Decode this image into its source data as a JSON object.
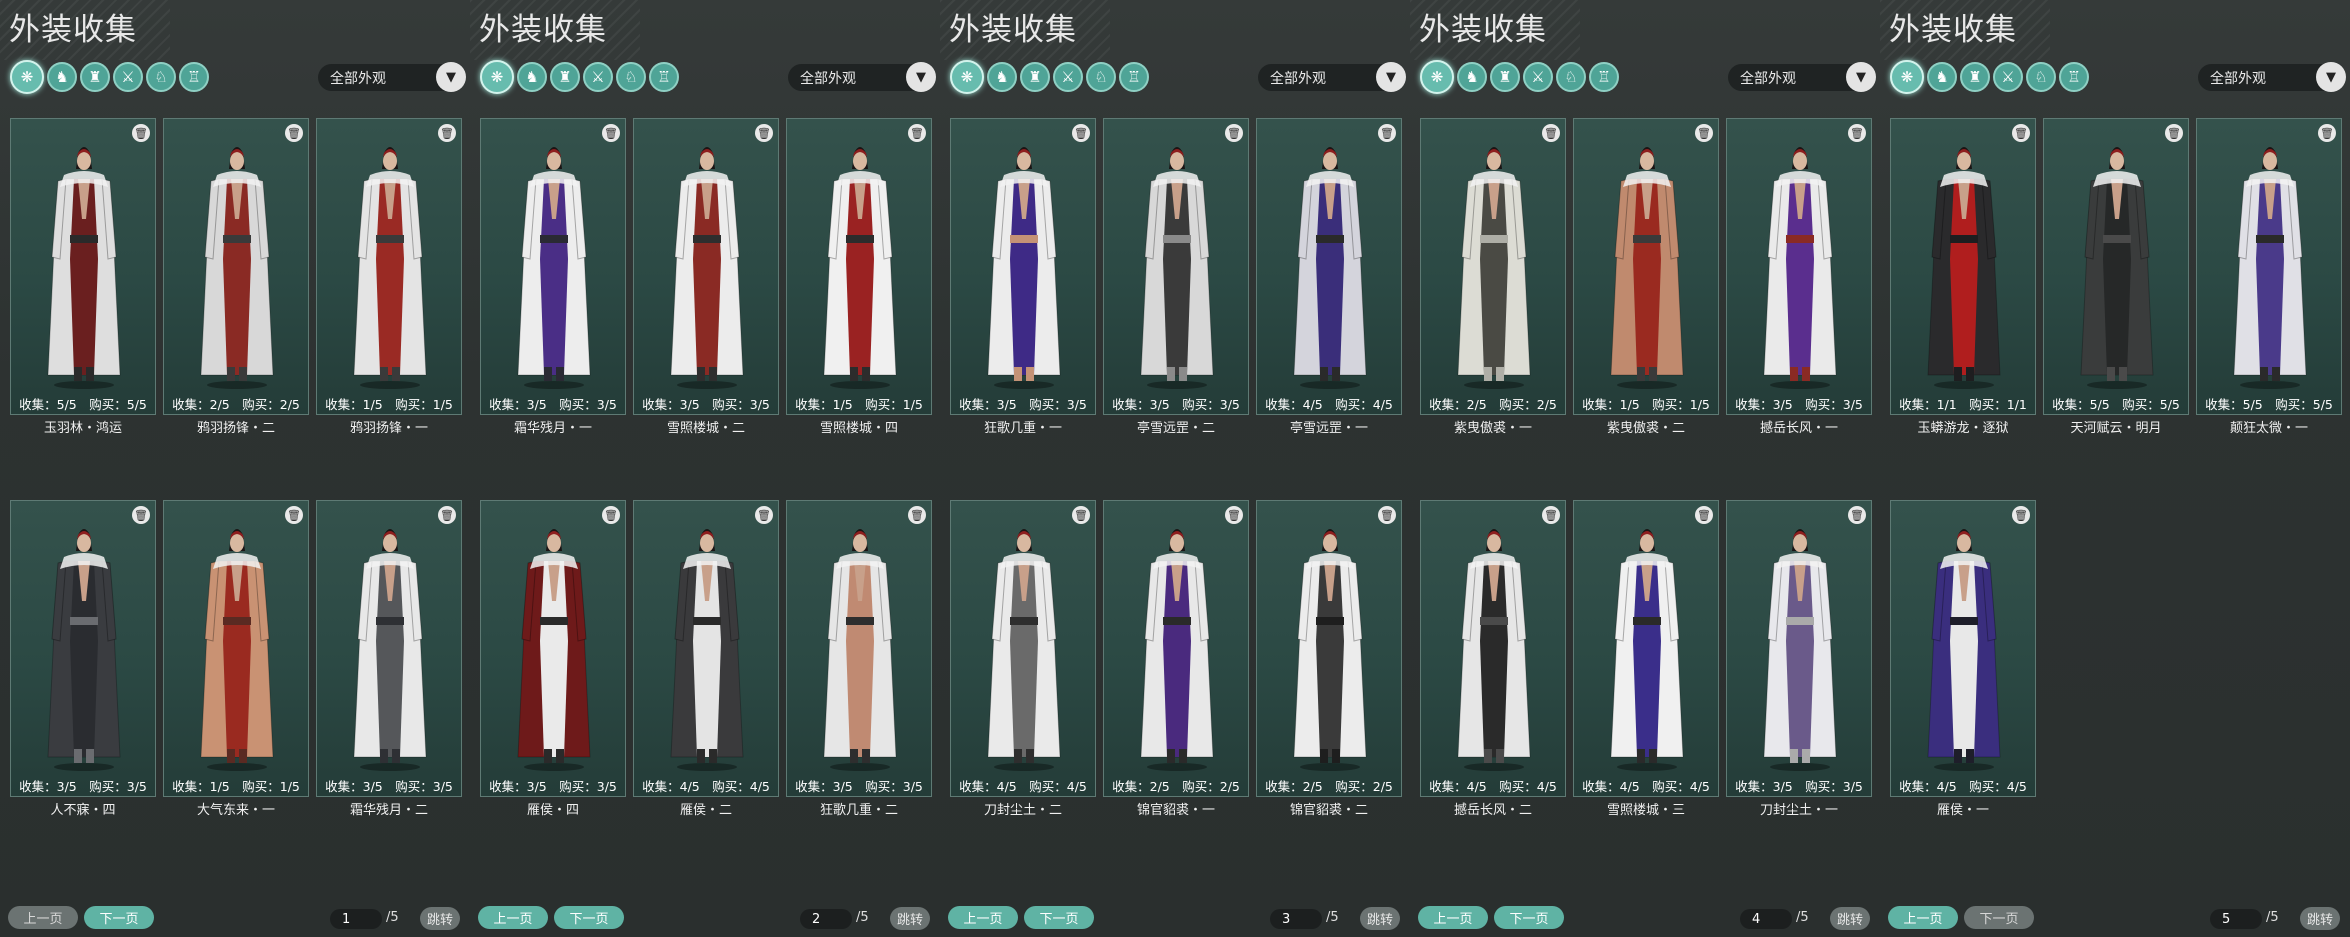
{
  "panels": [
    {
      "title": "外装收集",
      "filter_label": "全部外观",
      "page": "1",
      "total": "/5",
      "prev_label": "上一页",
      "next_label": "下一页",
      "jump_label": "跳转",
      "prev_enabled": false,
      "next_enabled": true,
      "items": [
        {
          "counts": "收集：5/5　购买：5/5",
          "name": "玉羽林・鸿运",
          "colors": [
            "#dedede",
            "#6a1f1f",
            "#2a2a2a"
          ]
        },
        {
          "counts": "收集：2/5　购买：2/5",
          "name": "鸦羽扬锋・二",
          "colors": [
            "#d8d8d8",
            "#8a2a24",
            "#3a3a3a"
          ]
        },
        {
          "counts": "收集：1/5　购买：1/5",
          "name": "鸦羽扬锋・一",
          "colors": [
            "#e4e4e4",
            "#9a2a24",
            "#3a3a3a"
          ]
        },
        {
          "counts": "收集：3/5　购买：3/5",
          "name": "人不寐・四",
          "colors": [
            "#3a3c40",
            "#2a2c30",
            "#6a6c70"
          ]
        },
        {
          "counts": "收集：1/5　购买：1/5",
          "name": "大气东来・一",
          "colors": [
            "#c99273",
            "#9a2a20",
            "#5a2a22"
          ]
        },
        {
          "counts": "收集：3/5　购买：3/5",
          "name": "霜华残月・二",
          "colors": [
            "#e8e8e8",
            "#55575a",
            "#2e3034"
          ]
        }
      ]
    },
    {
      "title": "外装收集",
      "filter_label": "全部外观",
      "page": "2",
      "total": "/5",
      "prev_label": "上一页",
      "next_label": "下一页",
      "jump_label": "跳转",
      "prev_enabled": true,
      "next_enabled": true,
      "items": [
        {
          "counts": "收集：3/5　购买：3/5",
          "name": "霜华残月・一",
          "colors": [
            "#ededed",
            "#4a2e86",
            "#2a2a34"
          ]
        },
        {
          "counts": "收集：3/5　购买：3/5",
          "name": "雪照楼城・二",
          "colors": [
            "#ececec",
            "#8a2a24",
            "#2e2e2e"
          ]
        },
        {
          "counts": "收集：1/5　购买：1/5",
          "name": "雪照楼城・四",
          "colors": [
            "#f0f0f0",
            "#9a2222",
            "#2c2c2c"
          ]
        },
        {
          "counts": "收集：3/5　购买：3/5",
          "name": "雁侯・四",
          "colors": [
            "#6e1a1a",
            "#eaeaea",
            "#2a2a2a"
          ]
        },
        {
          "counts": "收集：4/5　购买：4/5",
          "name": "雁侯・二",
          "colors": [
            "#3a3a3c",
            "#e4e4e4",
            "#2a2a2a"
          ]
        },
        {
          "counts": "收集：3/5　购买：3/5",
          "name": "狂歌几重・二",
          "colors": [
            "#e6e6e6",
            "#c08a72",
            "#2e2e2e"
          ]
        }
      ]
    },
    {
      "title": "外装收集",
      "filter_label": "全部外观",
      "page": "3",
      "total": "/5",
      "prev_label": "上一页",
      "next_label": "下一页",
      "jump_label": "跳转",
      "prev_enabled": true,
      "next_enabled": true,
      "items": [
        {
          "counts": "收集：3/5　购买：3/5",
          "name": "狂歌几重・一",
          "colors": [
            "#ececec",
            "#3e2a86",
            "#c49276"
          ]
        },
        {
          "counts": "收集：3/5　购买：3/5",
          "name": "亭雪远罡・二",
          "colors": [
            "#d8d8d8",
            "#3a3a3a",
            "#8a8a8a"
          ]
        },
        {
          "counts": "收集：4/5　购买：4/5",
          "name": "亭雪远罡・一",
          "colors": [
            "#d4d4dc",
            "#3a2e7a",
            "#2a2a2a"
          ]
        },
        {
          "counts": "收集：4/5　购买：4/5",
          "name": "刀封尘土・二",
          "colors": [
            "#eaeaea",
            "#6a6a6a",
            "#2e2e2e"
          ]
        },
        {
          "counts": "收集：2/5　购买：2/5",
          "name": "锦官貂裘・一",
          "colors": [
            "#e8e8e8",
            "#4a2a7e",
            "#2a2a2a"
          ]
        },
        {
          "counts": "收集：2/5　购买：2/5",
          "name": "锦官貂裘・二",
          "colors": [
            "#ececec",
            "#3a3a3a",
            "#1e1e1e"
          ]
        }
      ]
    },
    {
      "title": "外装收集",
      "filter_label": "全部外观",
      "page": "4",
      "total": "/5",
      "prev_label": "上一页",
      "next_label": "下一页",
      "jump_label": "跳转",
      "prev_enabled": true,
      "next_enabled": true,
      "items": [
        {
          "counts": "收集：2/5　购买：2/5",
          "name": "紫曳傲裘・一",
          "colors": [
            "#dcdcd4",
            "#4a4a44",
            "#aeaea6"
          ]
        },
        {
          "counts": "收集：1/5　购买：1/5",
          "name": "紫曳傲裘・二",
          "colors": [
            "#c08a6e",
            "#9a2a20",
            "#3a3a3a"
          ]
        },
        {
          "counts": "收集：3/5　购买：3/5",
          "name": "撼岳长风・一",
          "colors": [
            "#eaeaea",
            "#5a2e8e",
            "#8a2a24"
          ]
        },
        {
          "counts": "收集：4/5　购买：4/5",
          "name": "撼岳长风・二",
          "colors": [
            "#e6e6e6",
            "#2a2a2a",
            "#4a4a4a"
          ]
        },
        {
          "counts": "收集：4/5　购买：4/5",
          "name": "雪照楼城・三",
          "colors": [
            "#f0f0f0",
            "#3a2e8a",
            "#2a2a2a"
          ]
        },
        {
          "counts": "收集：3/5　购买：3/5",
          "name": "刀封尘土・一",
          "colors": [
            "#e8e8ec",
            "#6a5a8a",
            "#aaaaaa"
          ]
        }
      ]
    },
    {
      "title": "外装收集",
      "filter_label": "全部外观",
      "page": "5",
      "total": "/5",
      "prev_label": "上一页",
      "next_label": "下一页",
      "jump_label": "跳转",
      "prev_enabled": true,
      "next_enabled": false,
      "items": [
        {
          "counts": "收集：1/1　购买：1/1",
          "name": "玉蟒游龙・逐狱",
          "colors": [
            "#2a2a2c",
            "#b01e1e",
            "#1e1e20"
          ]
        },
        {
          "counts": "收集：5/5　购买：5/5",
          "name": "天河赋云・明月",
          "colors": [
            "#3a3c3c",
            "#262828",
            "#4a4a4a"
          ]
        },
        {
          "counts": "收集：5/5　购买：5/5",
          "name": "颠狂太微・一",
          "colors": [
            "#e0e0e6",
            "#4a3a8a",
            "#2a2a2a"
          ]
        },
        {
          "counts": "收集：4/5　购买：4/5",
          "name": "雁侯・一",
          "colors": [
            "#3a2e7e",
            "#e8e8e8",
            "#1e1e2a"
          ]
        }
      ]
    }
  ],
  "filter_icons": [
    {
      "name": "all-outfits-icon",
      "glyph": "❋"
    },
    {
      "name": "top-outfit-icon",
      "glyph": "♞"
    },
    {
      "name": "hat-icon",
      "glyph": "♜"
    },
    {
      "name": "weapon-skin-icon",
      "glyph": "⚔"
    },
    {
      "name": "mount-icon",
      "glyph": "♘"
    },
    {
      "name": "pendant-icon",
      "glyph": "♖"
    }
  ]
}
